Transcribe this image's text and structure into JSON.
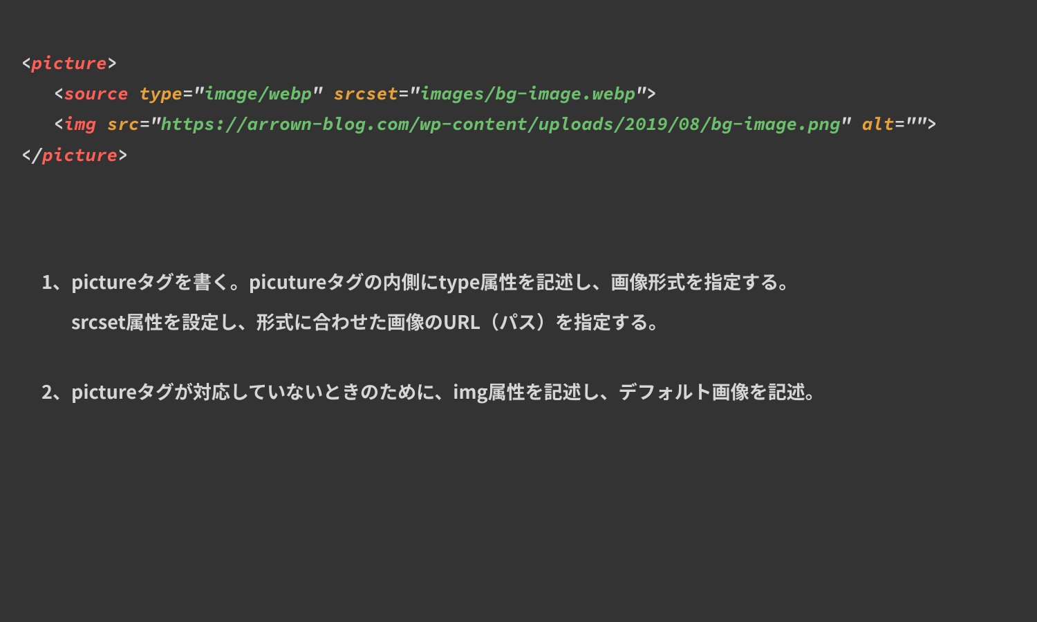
{
  "code": {
    "line1": {
      "lt": "<",
      "tag": "picture",
      "gt": ">"
    },
    "line2": {
      "indent": "   ",
      "lt": "<",
      "tag": "source",
      "sp1": " ",
      "attr1": "type",
      "eq1": "=",
      "q1a": "\"",
      "val1": "image/webp",
      "q1b": "\"",
      "sp2": " ",
      "attr2": "srcset",
      "eq2": "=",
      "q2a": "\"",
      "val2": "images/bg-image.webp",
      "q2b": "\"",
      "gt": ">"
    },
    "line3": {
      "indent": "   ",
      "lt": "<",
      "tag": "img",
      "sp1": " ",
      "attr1": "src",
      "eq1": "=",
      "q1a": "\"",
      "val1": "https://arrown-blog.com/wp-content/uploads/2019/08/bg-image.png",
      "q1b": "\"",
      "sp2": " ",
      "attr2": "alt",
      "eq2": "=",
      "q2a": "\"",
      "val2": "",
      "q2b": "\"",
      "gt": ">"
    },
    "line4": {
      "lt": "</",
      "tag": "picture",
      "gt": ">"
    }
  },
  "explain": {
    "item1": {
      "num": "1、",
      "line1": "pictureタグを書く。picutureタグの内側にtype属性を記述し、画像形式を指定する。",
      "line2": "srcset属性を設定し、形式に合わせた画像のURL（パス）を指定する。"
    },
    "item2": {
      "num": "2、",
      "line1": "pictureタグが対応していないときのために、img属性を記述し、デフォルト画像を記述。"
    }
  }
}
